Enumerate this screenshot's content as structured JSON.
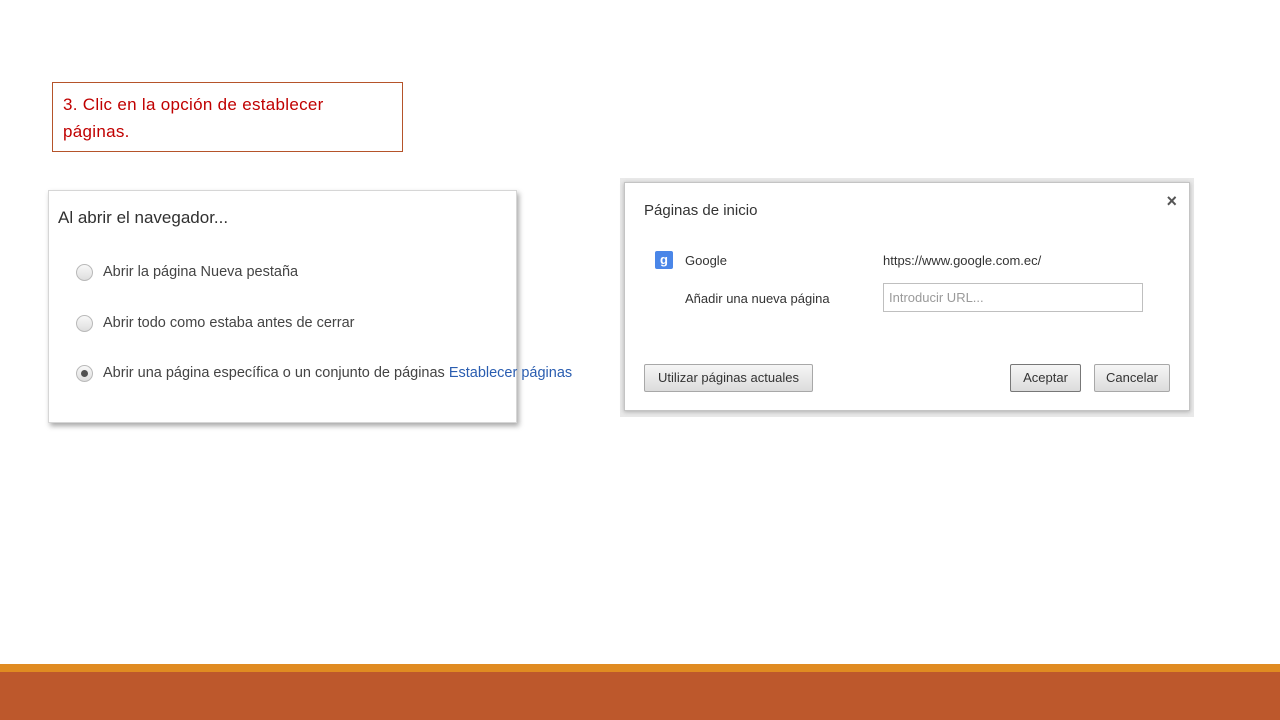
{
  "instruction": {
    "line1": "3.  Clic en la  opción de establecer",
    "line2": "páginas."
  },
  "startup_panel": {
    "title": "Al abrir el navegador...",
    "options": [
      {
        "label": "Abrir la página Nueva pestaña",
        "selected": false
      },
      {
        "label": "Abrir todo como estaba antes de cerrar",
        "selected": false
      },
      {
        "label": "Abrir una página específica o un conjunto de páginas",
        "selected": true
      }
    ],
    "set_pages_link": "Establecer páginas",
    "link_color": "#2a5db0"
  },
  "dialog": {
    "title": "Páginas de inicio",
    "close_icon": "close-icon",
    "site": {
      "icon": "google-icon",
      "icon_glyph": "g",
      "name": "Google",
      "url": "https://www.google.com.ec/"
    },
    "add_page_label": "Añadir una nueva página",
    "url_input": {
      "value": "",
      "placeholder": "Introducir URL..."
    },
    "buttons": {
      "use_current": "Utilizar páginas actuales",
      "accept": "Aceptar",
      "cancel": "Cancelar"
    }
  },
  "colors": {
    "instruction_text": "#c00000",
    "instruction_border": "#b5532a",
    "footer_strip": "#e08b21",
    "footer_band": "#bd582c"
  }
}
